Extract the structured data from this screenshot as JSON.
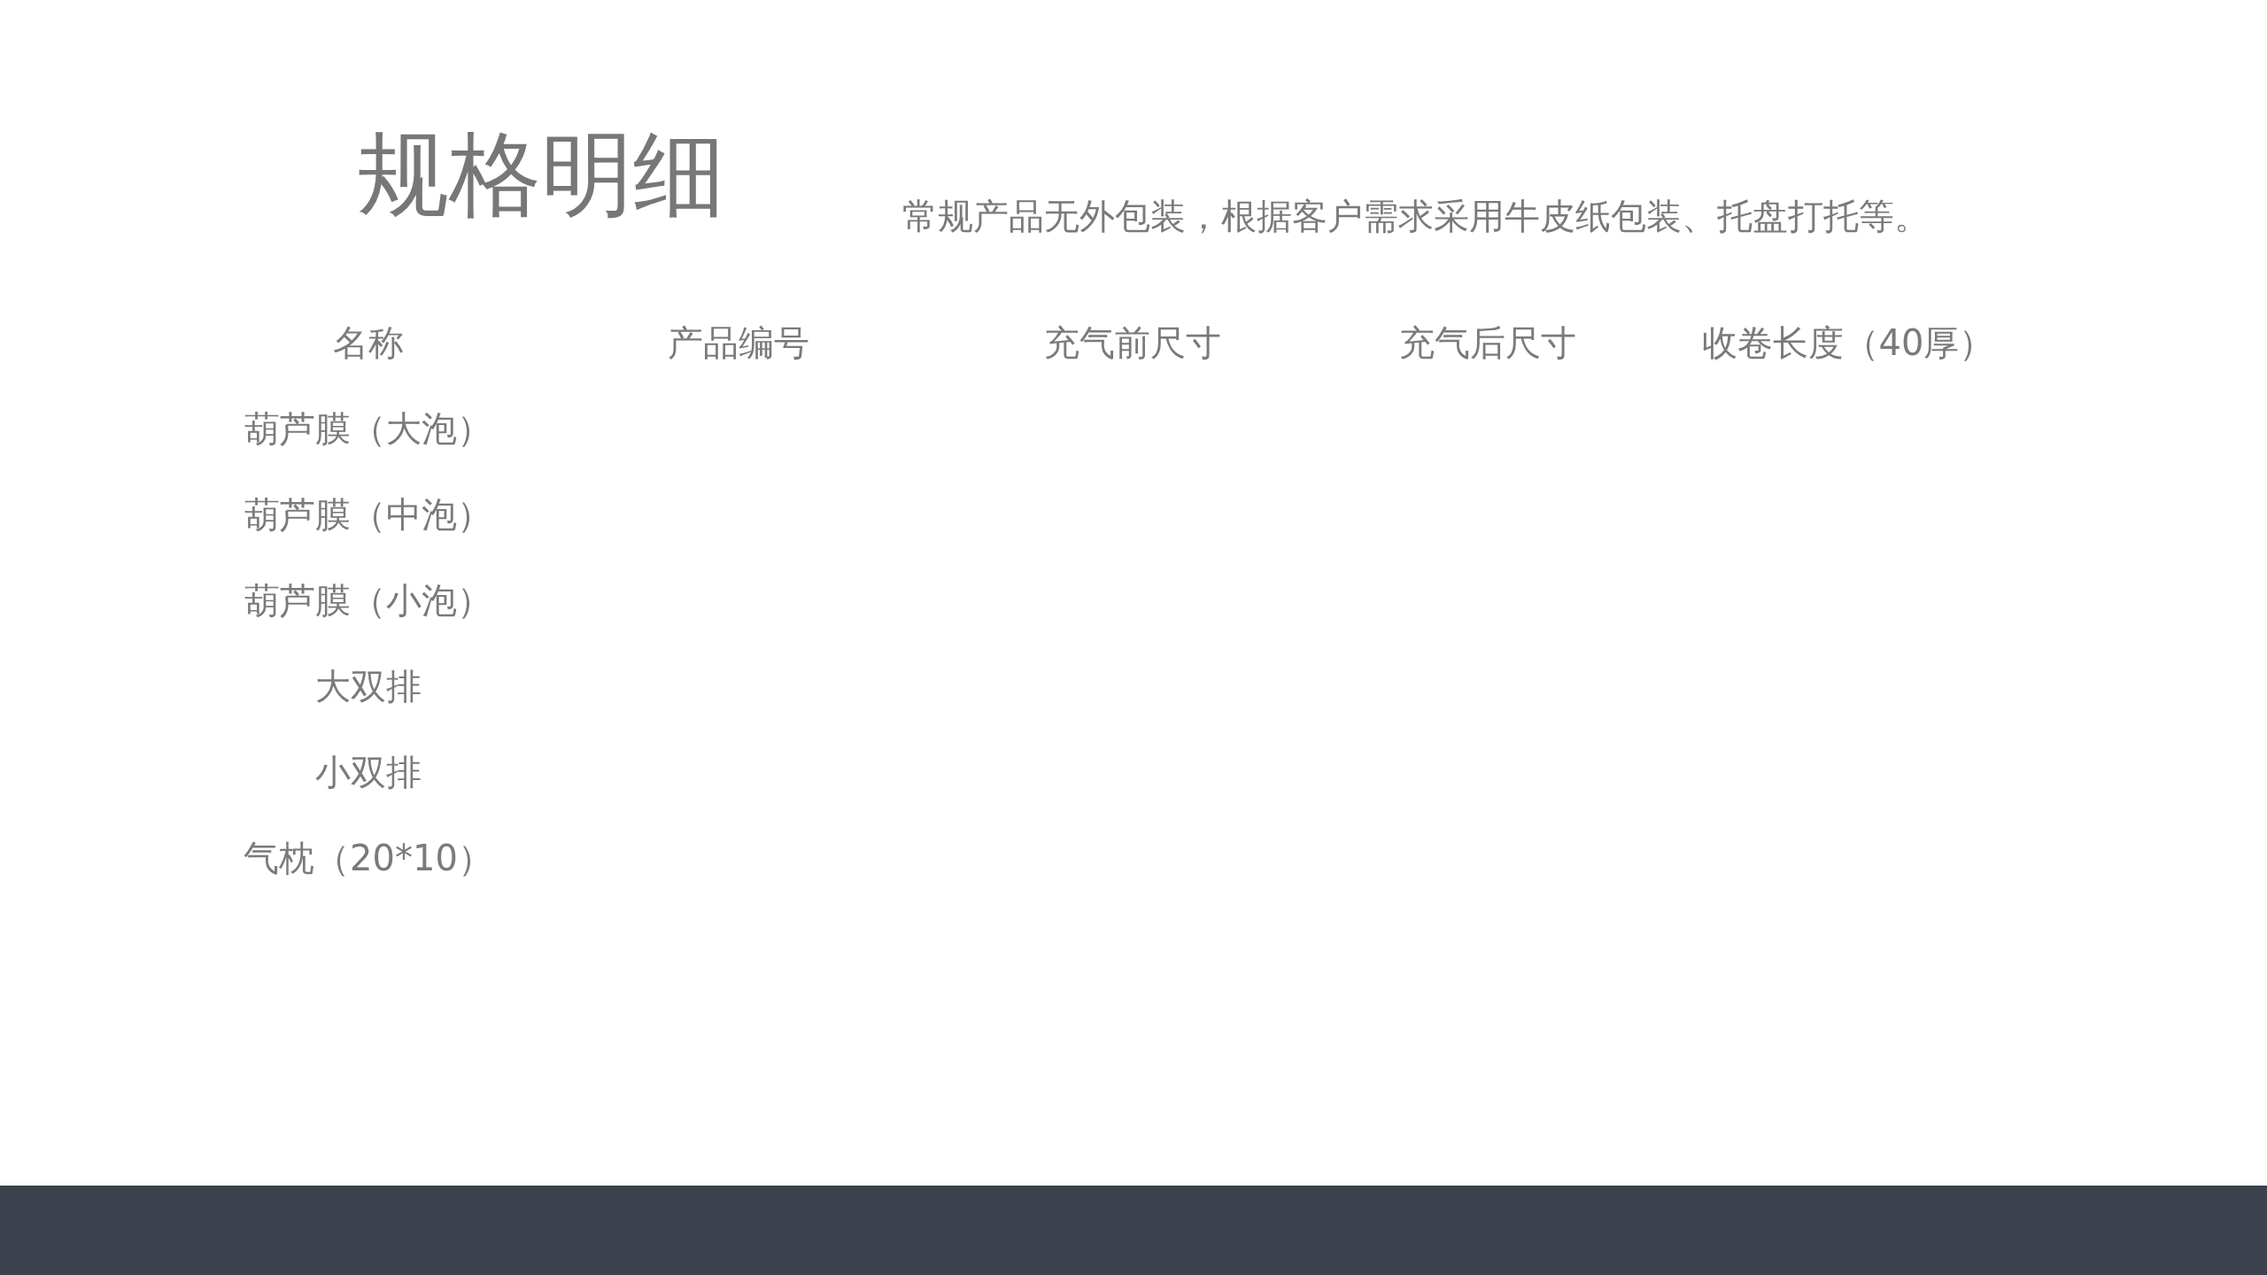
{
  "title": "规格明细",
  "note": "常规产品无外包装，根据客户需求采用牛皮纸包装、托盘打托等。",
  "table": {
    "columns": [
      "名称",
      "产品编号",
      "充气前尺寸",
      "充气后尺寸",
      "收卷长度（40厚）"
    ],
    "rows": [
      "葫芦膜（大泡）",
      "葫芦膜（中泡）",
      "葫芦膜（小泡）",
      "大双排",
      "小双排",
      "气枕（20*10）"
    ]
  }
}
